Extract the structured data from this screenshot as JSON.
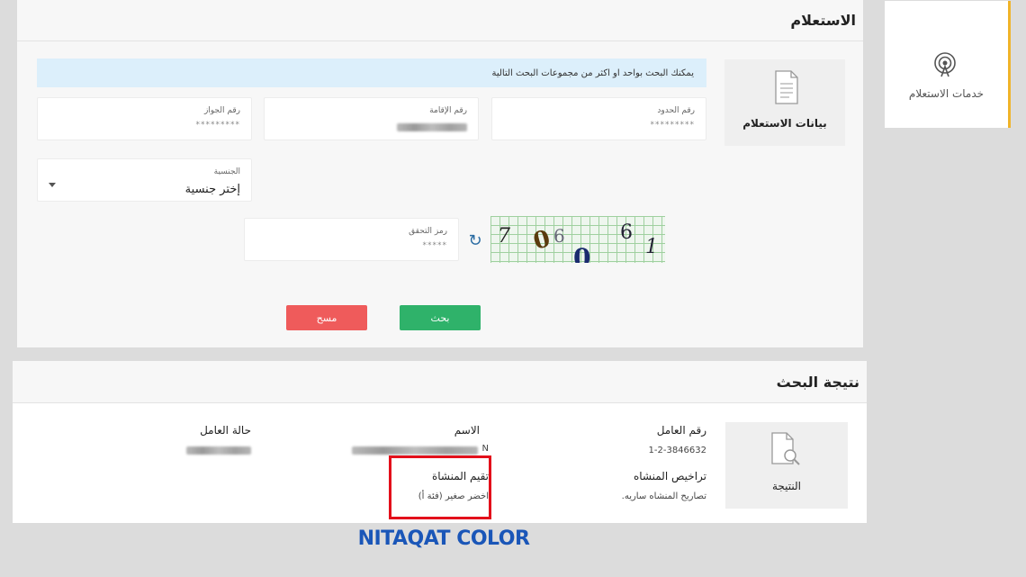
{
  "sidebar": {
    "service_label": "خدمات الاستعلام",
    "accent_color": "#f0b429"
  },
  "inquiry": {
    "title": "الاستعلام",
    "side_label": "بيانات الاستعلام",
    "banner": "يمكنك البحث بواحد او اكثر من مجموعات البحث التالية",
    "fields": {
      "border_number": {
        "label": "رقم الحدود",
        "value": "*********"
      },
      "iqama_number": {
        "label": "رقم الإقامة",
        "value": ""
      },
      "passport_number": {
        "label": "رقم الجواز",
        "value": "*********"
      },
      "nationality": {
        "label": "الجنسية",
        "value": "إختر جنسية"
      },
      "captcha": {
        "label": "رمز التحقق",
        "value": "*****"
      }
    },
    "captcha_glyphs": [
      "7",
      "0",
      "6",
      "0",
      "6",
      "1"
    ],
    "search_button": "بحث",
    "clear_button": "مسح",
    "colors": {
      "search": "#2fb26a",
      "clear": "#ef5b5b",
      "banner": "#dceffb"
    }
  },
  "result": {
    "title": "نتيجة البحث",
    "side_label": "النتيجة",
    "worker_number_label": "رقم العامل",
    "worker_number_value": "1-2-3846632",
    "name_label": "الاسم",
    "name_suffix": "N",
    "status_label": "حالة العامل",
    "licenses_label": "تراخيص المنشاه",
    "licenses_value": "تصاريح المنشاه ساريه.",
    "rating_label": "تقيم المنشاة",
    "rating_value": "اخضر صغير (فئة أ)"
  },
  "annotation": {
    "caption": "NITAQAT COLOR",
    "highlight_color": "#e3101b",
    "caption_color": "#1a56b8"
  }
}
